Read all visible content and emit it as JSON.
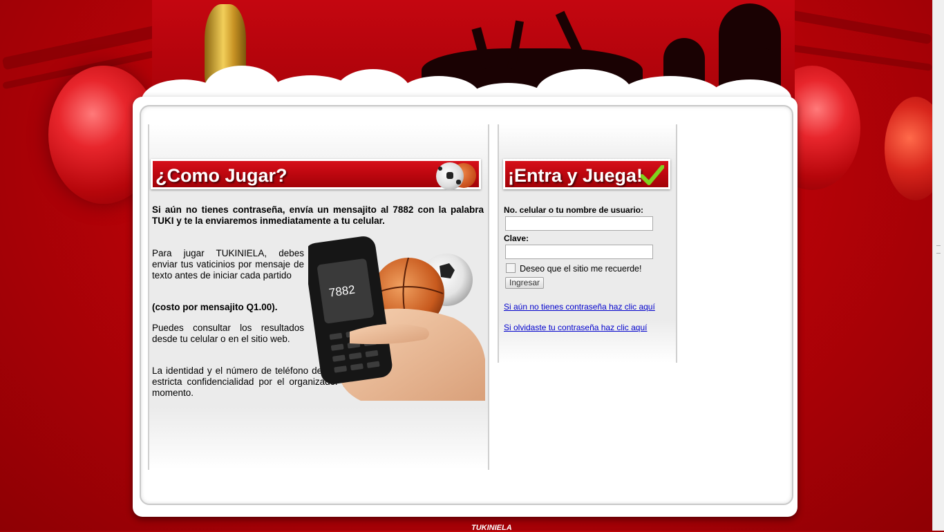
{
  "page": {
    "colors": {
      "brand_red": "#c20811",
      "link": "#0000cc",
      "panel_bg": "#ffffff"
    }
  },
  "how_to_play": {
    "title": "¿Como Jugar?",
    "intro": "Si aún no tienes contraseña, envía un mensajito al 7882 con la palabra TUKI y te la enviaremos inmediatamente a tu celular.",
    "paragraph_1": "Para jugar TUKINIELA, debes enviar tus vaticinios por mensaje de texto antes de iniciar cada partido",
    "paragraph_2": "(costo por mensajito Q1.00).",
    "paragraph_3": "Puedes consultar los resultados desde tu celular o en el sitio web.",
    "paragraph_4": "La identidad y el número de teléfono de los participantes será mantenida bajo estricta confidencialidad por el organizador y no se hará pública en ningún momento.",
    "phone_screen_number": "7882",
    "icons": [
      "soccer-ball-icon",
      "basketball-icon"
    ]
  },
  "login": {
    "title": "¡Entra y Juega!",
    "title_icon": "checkmark-icon",
    "username_label": "No. celular o tu nombre de usuario:",
    "username_value": "",
    "password_label": "Clave:",
    "password_value": "",
    "remember_label": "Deseo que el sitio me recuerde!",
    "remember_checked": false,
    "submit_label": "Ingresar",
    "register_link": "Si aún no tienes contraseña haz clic aquí",
    "forgot_link": "Si olvidaste tu contraseña haz clic aquí"
  },
  "footer": {
    "logo_text": "TUKINIELA"
  }
}
